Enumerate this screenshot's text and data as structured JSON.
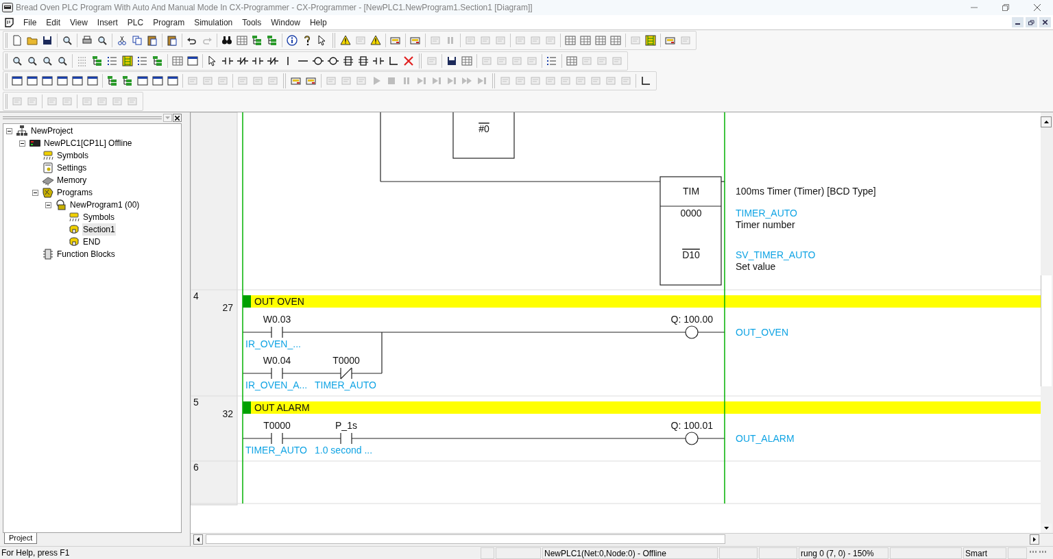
{
  "window": {
    "title": "Bread Oven PLC Program With Auto And Manual Mode In CX-Programmer - CX-Programmer - [NewPLC1.NewProgram1.Section1 [Diagram]]"
  },
  "menu": [
    "File",
    "Edit",
    "View",
    "Insert",
    "PLC",
    "Program",
    "Simulation",
    "Tools",
    "Window",
    "Help"
  ],
  "project_tree": [
    {
      "label": "NewProject",
      "kind": "project",
      "selected": false,
      "expanded": true,
      "children": [
        {
          "label": "NewPLC1[CP1L] Offline",
          "kind": "plc",
          "selected": false,
          "expanded": true,
          "children": [
            {
              "label": "Symbols",
              "kind": "symbols",
              "selected": false
            },
            {
              "label": "Settings",
              "kind": "settings",
              "selected": false
            },
            {
              "label": "Memory",
              "kind": "memory",
              "selected": false
            },
            {
              "label": "Programs",
              "kind": "programs",
              "selected": false,
              "expanded": true,
              "children": [
                {
                  "label": "NewProgram1 (00)",
                  "kind": "program",
                  "selected": false,
                  "expanded": true,
                  "children": [
                    {
                      "label": "Symbols",
                      "kind": "symbols",
                      "selected": false
                    },
                    {
                      "label": "Section1",
                      "kind": "section",
                      "selected": true
                    },
                    {
                      "label": "END",
                      "kind": "section",
                      "selected": false
                    }
                  ]
                }
              ]
            },
            {
              "label": "Function Blocks",
              "kind": "function_blocks",
              "selected": false
            }
          ]
        }
      ]
    }
  ],
  "panel_tabs": [
    {
      "label": "Project",
      "selected": true
    }
  ],
  "rungs": [
    {
      "kind": "instruction_tail",
      "operand": {
        "value": "#0",
        "overline": true
      },
      "instruction": "TIM",
      "description": "100ms Timer (Timer) [BCD Type]",
      "operands": [
        {
          "value": "0000",
          "overline": false,
          "symbol": "TIMER_AUTO",
          "comment": "Timer number"
        },
        {
          "value": "D10",
          "overline": true,
          "symbol": "SV_TIMER_AUTO",
          "comment": "Set value"
        }
      ]
    },
    {
      "kind": "rung",
      "number": "4",
      "step": "27",
      "comment": "OUT OVEN",
      "branches": [
        [
          {
            "kind": "no",
            "address": "W0.03",
            "symbol": "IR_OVEN_..."
          }
        ],
        [
          {
            "kind": "no",
            "address": "W0.04",
            "symbol": "IR_OVEN_A..."
          },
          {
            "kind": "nc",
            "address": "T0000",
            "symbol": "TIMER_AUTO"
          }
        ]
      ],
      "coil": {
        "address": "Q: 100.00",
        "symbol": "OUT_OVEN"
      }
    },
    {
      "kind": "rung",
      "number": "5",
      "step": "32",
      "comment": "OUT ALARM",
      "branches": [
        [
          {
            "kind": "no",
            "address": "T0000",
            "symbol": "TIMER_AUTO"
          },
          {
            "kind": "no",
            "address": "P_1s",
            "symbol": "1.0 second ..."
          }
        ]
      ],
      "coil": {
        "address": "Q: 100.01",
        "symbol": "OUT_ALARM"
      }
    },
    {
      "kind": "empty",
      "number": "6"
    }
  ],
  "status_bar": {
    "help": "For Help, press F1",
    "connection": "NewPLC1(Net:0,Node:0) - Offline",
    "position": "rung 0 (7, 0) - 150%",
    "mode": "Smart"
  }
}
